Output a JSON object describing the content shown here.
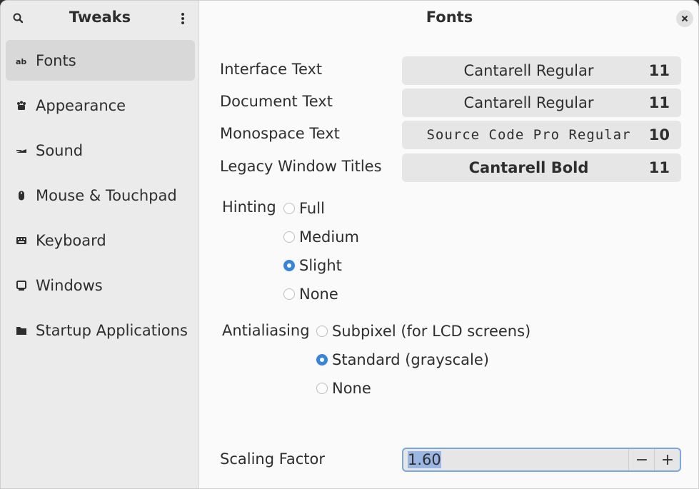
{
  "sidebar": {
    "title": "Tweaks",
    "items": [
      {
        "label": "Fonts",
        "icon": "font-icon"
      },
      {
        "label": "Appearance",
        "icon": "appearance-icon"
      },
      {
        "label": "Sound",
        "icon": "sound-icon"
      },
      {
        "label": "Mouse & Touchpad",
        "icon": "mouse-icon"
      },
      {
        "label": "Keyboard",
        "icon": "keyboard-icon"
      },
      {
        "label": "Windows",
        "icon": "window-icon"
      },
      {
        "label": "Startup Applications",
        "icon": "folder-icon"
      }
    ]
  },
  "main": {
    "title": "Fonts",
    "fonts": [
      {
        "label": "Interface Text",
        "font": "Cantarell Regular",
        "size": "11"
      },
      {
        "label": "Document Text",
        "font": "Cantarell Regular",
        "size": "11"
      },
      {
        "label": "Monospace Text",
        "font": "Source Code Pro Regular",
        "size": "10"
      },
      {
        "label": "Legacy Window Titles",
        "font": "Cantarell Bold",
        "size": "11"
      }
    ],
    "hinting": {
      "label": "Hinting",
      "options": [
        "Full",
        "Medium",
        "Slight",
        "None"
      ],
      "selected": "Slight"
    },
    "antialiasing": {
      "label": "Antialiasing",
      "options": [
        "Subpixel (for LCD screens)",
        "Standard (grayscale)",
        "None"
      ],
      "selected": "Standard (grayscale)"
    },
    "scaling": {
      "label": "Scaling Factor",
      "value": "1.60",
      "minus": "−",
      "plus": "+"
    }
  },
  "colors": {
    "accent": "#3584e4",
    "sidebar_bg": "#ebebeb",
    "selected_bg": "#d8d8d8"
  }
}
